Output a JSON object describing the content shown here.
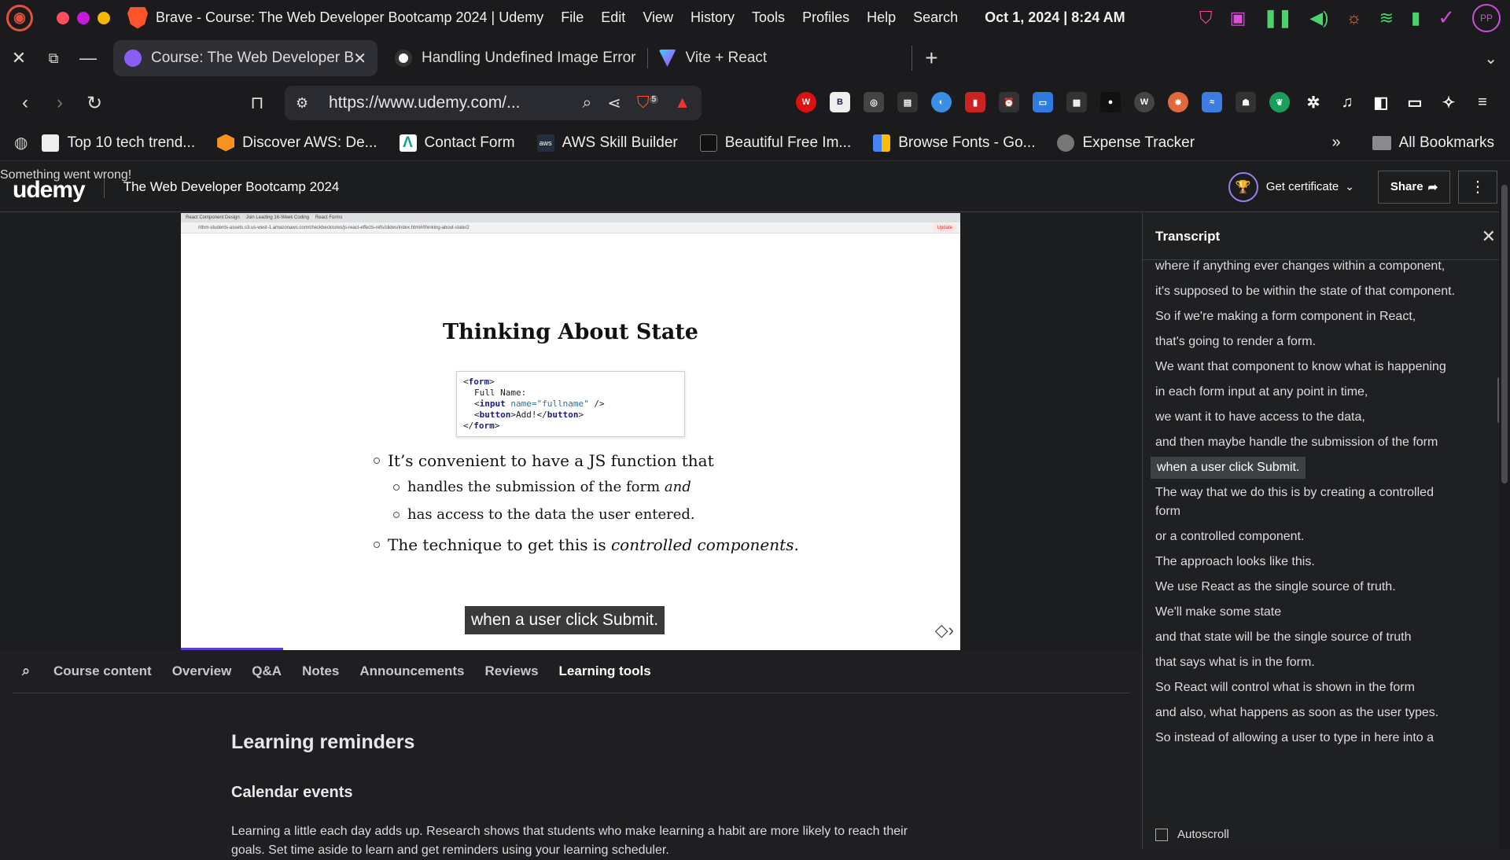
{
  "menubar": {
    "app_title": "Brave - Course: The Web Developer Bootcamp 2024 | Udemy",
    "menus": [
      "File",
      "Edit",
      "View",
      "History",
      "Tools",
      "Profiles",
      "Help",
      "Search"
    ],
    "clock": "Oct 1, 2024 | 8:24 AM",
    "avatar": "PP"
  },
  "tabs": [
    {
      "label": "Course: The Web Developer B",
      "active": true
    },
    {
      "label": "Handling Undefined Image Error",
      "active": false
    },
    {
      "label": "Vite + React",
      "active": false
    }
  ],
  "navbar": {
    "url": "https://www.udemy.com/...",
    "shield_count": "5"
  },
  "bookmarks": [
    {
      "label": "Top 10 tech trend..."
    },
    {
      "label": "Discover AWS: De..."
    },
    {
      "label": "Contact Form"
    },
    {
      "label": "AWS Skill Builder"
    },
    {
      "label": "Beautiful Free Im..."
    },
    {
      "label": "Browse Fonts - Go..."
    },
    {
      "label": "Expense Tracker"
    }
  ],
  "bookmarks_more": "»",
  "all_bookmarks": "All Bookmarks",
  "udemy": {
    "error": "Something went wrong!",
    "logo": "udemy",
    "course_title": "The Web Developer Bootcamp 2024",
    "certificate": "Get certificate",
    "share": "Share"
  },
  "slide": {
    "mini_tabs": [
      "React Component Design",
      "Join Leading 16-Week Coding",
      "React Forms"
    ],
    "mini_url": "rithm-students-assets.s3.us-west-1.amazonaws.com/checkbeck/ures/js-react-effects-refs/slides/index.html#/thinking-about-state/2",
    "mini_update": "Update",
    "title": "Thinking About State",
    "code": {
      "line1_open": "<",
      "line1_tag": "form",
      "line1_close": ">",
      "line2": "Full Name:",
      "line3_tag": "input",
      "line3_attr": "name=",
      "line3_val": "\"fullname\"",
      "line3_end": " />",
      "line4_tag": "button",
      "line4_text": "Add!",
      "line5_tag": "form"
    },
    "bullets": {
      "b1": "It’s convenient to have a JS function that",
      "b1a_pre": "handles the submission of the form",
      "b1a_em": "and",
      "b1b": "has access to the data the user entered.",
      "b2_pre": "The technique to get this is",
      "b2_em": "controlled components",
      "b2_post": "."
    },
    "caption": "when a user click Submit."
  },
  "course_tabs": [
    "Course content",
    "Overview",
    "Q&A",
    "Notes",
    "Announcements",
    "Reviews",
    "Learning tools"
  ],
  "active_course_tab": "Learning tools",
  "content": {
    "heading": "Learning reminders",
    "subheading": "Calendar events",
    "paragraph": "Learning a little each day adds up. Research shows that students who make learning a habit are more likely to reach their goals. Set time aside to learn and get reminders using your learning scheduler."
  },
  "transcript": {
    "title": "Transcript",
    "autoscroll": "Autoscroll",
    "cues": [
      "where if anything ever changes within a component,",
      "it's supposed to be within the state of that component.",
      "So if we're making a form component in React,",
      "that's going to render a form.",
      "We want that component to know what is happening",
      "in each form input at any point in time,",
      "we want it to have access to the data,",
      "and then maybe handle the submission of the form",
      "when a user click Submit.",
      "The way that we do this is by creating a controlled form",
      "or a controlled component.",
      "The approach looks like this.",
      "We use React as the single source of truth.",
      "We'll make some state",
      "and that state will be the single source of truth",
      "that says what is in the form.",
      "So React will control what is shown in the form",
      "and also, what happens as soon as the user types.",
      "So instead of allowing a user to type in here into a"
    ],
    "current_index": 8
  },
  "colors": {
    "brave_orange": "#fb542b",
    "udemy_purple": "#5e3fd0",
    "dark_bg": "#1c1d1f"
  }
}
